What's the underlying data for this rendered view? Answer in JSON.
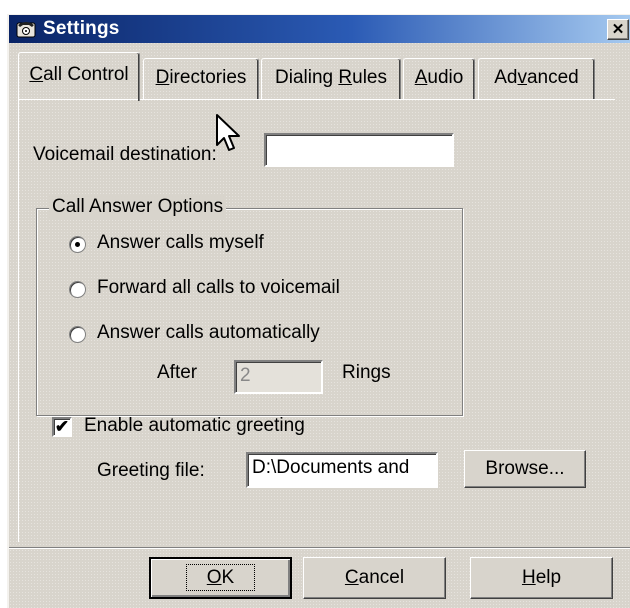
{
  "window": {
    "title": "Settings",
    "title_icon": "telephone-icon",
    "close_glyph": "✕"
  },
  "tabs": [
    {
      "label": "Call Control",
      "access": "C",
      "rest": "all Control",
      "active": true
    },
    {
      "label": "Directories",
      "access": "D",
      "rest": "irectories",
      "active": false
    },
    {
      "label": "Dialing Rules",
      "pre": "Dialing ",
      "access": "R",
      "rest": "ules",
      "active": false
    },
    {
      "label": "Audio",
      "access": "A",
      "rest": "udio",
      "active": false
    },
    {
      "label": "Advanced",
      "pre": "Ad",
      "access": "v",
      "rest": "anced",
      "active": false
    }
  ],
  "voicemail": {
    "label": "Voicemail destination:",
    "value": ""
  },
  "call_answer": {
    "legend": "Call Answer Options",
    "options": [
      {
        "label": "Answer calls myself",
        "checked": true
      },
      {
        "label": "Forward all calls to voicemail",
        "checked": false
      },
      {
        "label": "Answer calls automatically",
        "checked": false
      }
    ],
    "after_label": "After",
    "rings_value": "2",
    "rings_label": "Rings"
  },
  "greeting": {
    "checkbox_label": "Enable automatic greeting",
    "checked": true,
    "check_glyph": "✔",
    "file_label": "Greeting file:",
    "file_value": "D:\\Documents and",
    "browse_label": "Browse..."
  },
  "buttons": {
    "ok": {
      "access": "O",
      "rest": "K"
    },
    "cancel": {
      "access": "C",
      "rest": "ancel"
    },
    "help": {
      "access": "H",
      "rest": "elp"
    }
  },
  "colors": {
    "title_gradient_start": "#0a2466",
    "title_gradient_end": "#a6caf0",
    "dialog_face": "#d8d4cc"
  }
}
